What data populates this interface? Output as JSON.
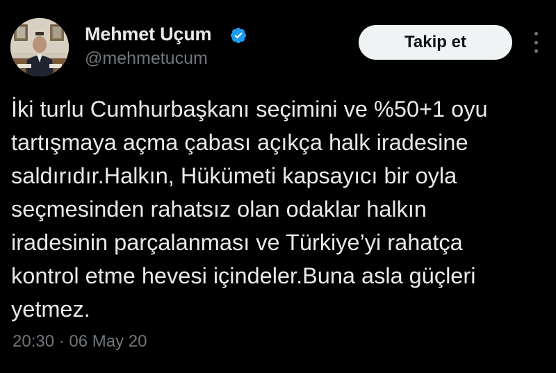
{
  "author": {
    "display_name": "Mehmet Uçum",
    "handle": "@mehmetucum",
    "verified": true,
    "avatar_icon": "profile-photo"
  },
  "actions": {
    "follow_label": "Takip et",
    "more_icon": "more-vertical-icon"
  },
  "tweet": {
    "lines": [
      "İki turlu Cumhurbaşkanı seçimini ve %50+1 oyu",
      "tartışmaya açma çabası açıkça halk iradesine",
      "saldırıdır.Halkın, Hükümeti kapsayıcı bir oyla",
      "seçmesinden rahatsız olan odaklar halkın",
      "iradesinin parçalanması ve Türkiye’yi rahatça",
      "kontrol etme hevesi içindeler.Buna asla güçleri",
      "yetmez."
    ],
    "timestamp": "20:30 · 06 May 20"
  },
  "colors": {
    "background": "#000000",
    "text_primary": "#e7e9ea",
    "text_secondary": "#71767b",
    "verified_badge": "#1d9bf0",
    "follow_button_bg": "#eff3f4"
  }
}
